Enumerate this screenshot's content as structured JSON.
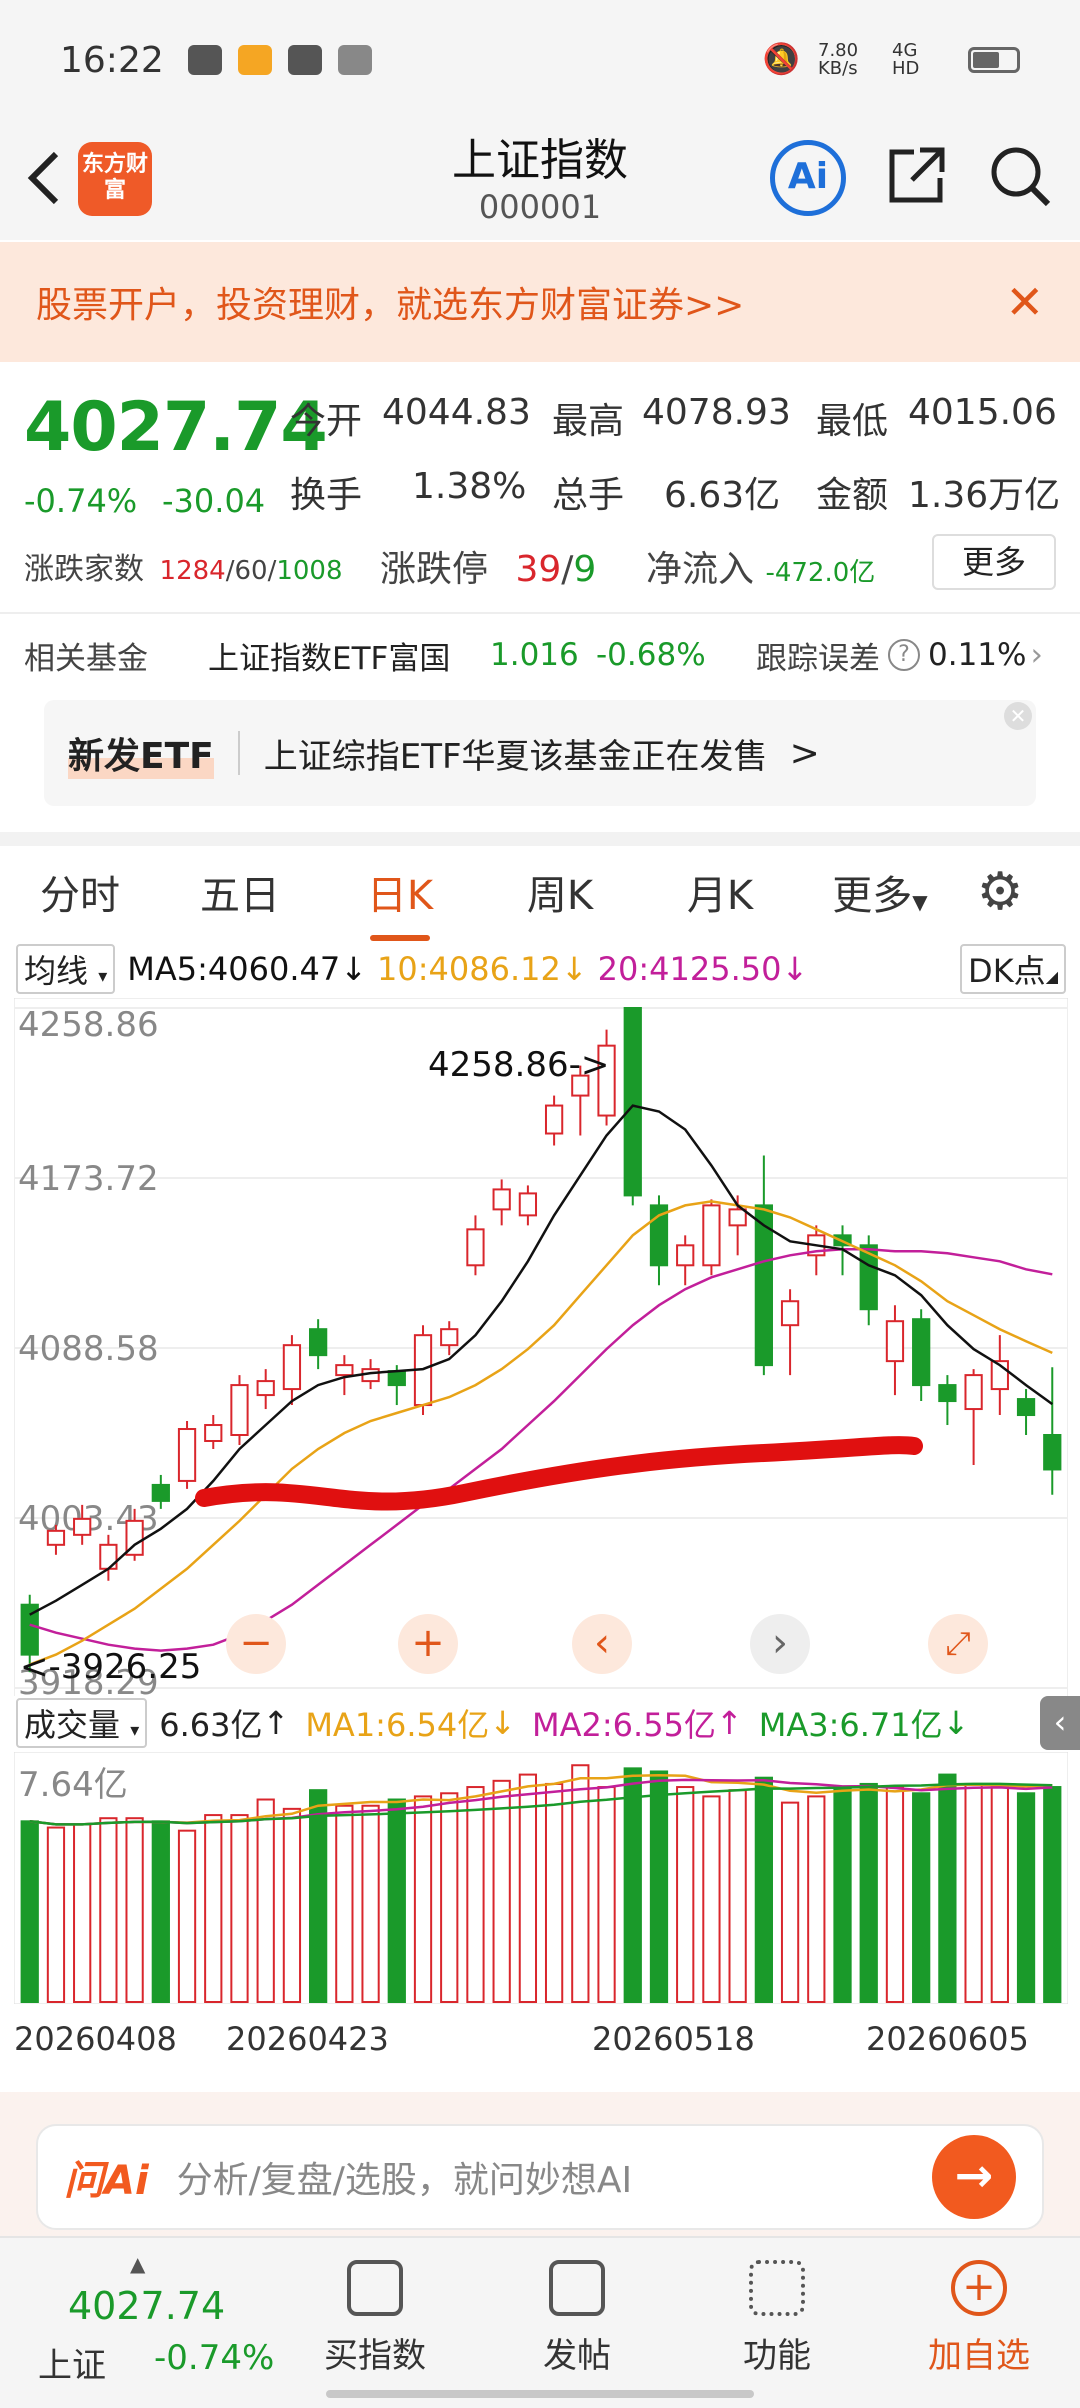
{
  "status": {
    "time": "16:22",
    "speed": "7.80 KB/s",
    "network": "4G HD"
  },
  "header": {
    "logo_text": "东方财富",
    "title": "上证指数",
    "code": "000001",
    "ai_label": "Ai"
  },
  "banner": {
    "text": "股票开户，投资理财，就选东方财富证券>>"
  },
  "quote": {
    "price": "4027.74",
    "change_pct": "-0.74%",
    "change_abs": "-30.04",
    "open_label": "今开",
    "open": "4044.83",
    "high_label": "最高",
    "high": "4078.93",
    "low_label": "最低",
    "low": "4015.06",
    "turnover_label": "换手",
    "turnover": "1.38%",
    "volume_label": "总手",
    "volume": "6.63亿",
    "amount_label": "金额",
    "amount": "1.36万亿",
    "breadth_label": "涨跌家数",
    "breadth_up": "1284",
    "breadth_flat": "60",
    "breadth_down": "1008",
    "limit_label": "涨跌停",
    "limit_up": "39",
    "limit_down": "9",
    "flow_label": "净流入",
    "flow": "-472.0亿",
    "more": "更多"
  },
  "fund": {
    "label": "相关基金",
    "name": "上证指数ETF富国",
    "price": "1.016",
    "change": "-0.68%",
    "track_label": "跟踪误差",
    "track": "0.11%"
  },
  "etf": {
    "tag": "新发ETF",
    "text": "上证综指ETF华夏该基金正在发售",
    "arrow": ">"
  },
  "tabs": [
    "分时",
    "五日",
    "日K",
    "周K",
    "月K",
    "更多"
  ],
  "ma": {
    "select": "均线",
    "ma5": "MA5:4060.47",
    "ma10": "10:4086.12",
    "ma20": "20:4125.50",
    "dk": "DK点"
  },
  "chart_labels": {
    "high_mark": "4258.86->",
    "low_mark": "<-3926.25",
    "y_ticks": [
      "4258.86",
      "4173.72",
      "4088.58",
      "4003.43",
      "3918.29"
    ]
  },
  "volume": {
    "select": "成交量",
    "vol": "6.63亿",
    "ma1": "MA1:6.54亿",
    "ma2": "MA2:6.55亿",
    "ma3": "MA3:6.71亿",
    "top": "7.64亿"
  },
  "dates": [
    "20260408",
    "20260423",
    "20260518",
    "20260605"
  ],
  "ask": {
    "brand": "问Ai",
    "placeholder": "分析/复盘/选股，就问妙想AI"
  },
  "bottom": {
    "price": "4027.74",
    "name": "上证",
    "pct": "-0.74%",
    "buy": "买指数",
    "post": "发帖",
    "func": "功能",
    "add": "加自选"
  },
  "colors": {
    "up": "#d9262c",
    "down": "#1a9a2a",
    "accent": "#e0561a"
  },
  "chart_data": {
    "type": "candlestick",
    "ylim": [
      3918.29,
      4258.86
    ],
    "candles": [
      {
        "o": 3960,
        "c": 3935,
        "h": 3965,
        "l": 3926.25
      },
      {
        "o": 3990,
        "c": 3997,
        "h": 4000,
        "l": 3985
      },
      {
        "o": 3995,
        "c": 4003,
        "h": 4010,
        "l": 3990
      },
      {
        "o": 3978,
        "c": 3990,
        "h": 3995,
        "l": 3972
      },
      {
        "o": 3985,
        "c": 4002,
        "h": 4008,
        "l": 3982
      },
      {
        "o": 4020,
        "c": 4012,
        "h": 4025,
        "l": 4008
      },
      {
        "o": 4022,
        "c": 4048,
        "h": 4052,
        "l": 4018
      },
      {
        "o": 4042,
        "c": 4050,
        "h": 4055,
        "l": 4038
      },
      {
        "o": 4045,
        "c": 4070,
        "h": 4075,
        "l": 4040
      },
      {
        "o": 4065,
        "c": 4072,
        "h": 4078,
        "l": 4058
      },
      {
        "o": 4068,
        "c": 4090,
        "h": 4095,
        "l": 4060
      },
      {
        "o": 4098,
        "c": 4085,
        "h": 4103,
        "l": 4078
      },
      {
        "o": 4075,
        "c": 4080,
        "h": 4085,
        "l": 4065
      },
      {
        "o": 4072,
        "c": 4078,
        "h": 4083,
        "l": 4068
      },
      {
        "o": 4077,
        "c": 4070,
        "h": 4080,
        "l": 4060
      },
      {
        "o": 4060,
        "c": 4095,
        "h": 4100,
        "l": 4055
      },
      {
        "o": 4090,
        "c": 4098,
        "h": 4102,
        "l": 4085
      },
      {
        "o": 4130,
        "c": 4148,
        "h": 4155,
        "l": 4125
      },
      {
        "o": 4158,
        "c": 4168,
        "h": 4173,
        "l": 4150
      },
      {
        "o": 4155,
        "c": 4166,
        "h": 4170,
        "l": 4150
      },
      {
        "o": 4196,
        "c": 4210,
        "h": 4215,
        "l": 4190
      },
      {
        "o": 4215,
        "c": 4225,
        "h": 4230,
        "l": 4195
      },
      {
        "o": 4205,
        "c": 4240,
        "h": 4248,
        "l": 4200
      },
      {
        "o": 4258.86,
        "c": 4165,
        "h": 4258.86,
        "l": 4160
      },
      {
        "o": 4160,
        "c": 4130,
        "h": 4165,
        "l": 4120
      },
      {
        "o": 4130,
        "c": 4140,
        "h": 4145,
        "l": 4120
      },
      {
        "o": 4130,
        "c": 4160,
        "h": 4163,
        "l": 4125
      },
      {
        "o": 4150,
        "c": 4158,
        "h": 4165,
        "l": 4135
      },
      {
        "o": 4160,
        "c": 4080,
        "h": 4185,
        "l": 4075
      },
      {
        "o": 4100,
        "c": 4112,
        "h": 4118,
        "l": 4075
      },
      {
        "o": 4135,
        "c": 4145,
        "h": 4150,
        "l": 4125
      },
      {
        "o": 4145,
        "c": 4140,
        "h": 4150,
        "l": 4125
      },
      {
        "o": 4140,
        "c": 4108,
        "h": 4145,
        "l": 4100
      },
      {
        "o": 4082,
        "c": 4102,
        "h": 4110,
        "l": 4065
      },
      {
        "o": 4103,
        "c": 4070,
        "h": 4108,
        "l": 4062
      },
      {
        "o": 4070,
        "c": 4062,
        "h": 4075,
        "l": 4050
      },
      {
        "o": 4058,
        "c": 4075,
        "h": 4078,
        "l": 4030
      },
      {
        "o": 4068,
        "c": 4082,
        "h": 4095,
        "l": 4055
      },
      {
        "o": 4063,
        "c": 4055,
        "h": 4068,
        "l": 4045
      },
      {
        "o": 4045,
        "c": 4027.74,
        "h": 4078.93,
        "l": 4015.06
      }
    ],
    "ma5": [
      3955,
      3962,
      3970,
      3978,
      3990,
      3998,
      4008,
      4022,
      4038,
      4050,
      4062,
      4070,
      4074,
      4076,
      4077,
      4078,
      4083,
      4095,
      4112,
      4132,
      4155,
      4175,
      4195,
      4210,
      4207,
      4198,
      4180,
      4160,
      4150,
      4142,
      4140,
      4138,
      4130,
      4125,
      4115,
      4100,
      4088,
      4080,
      4070,
      4060.47
    ],
    "ma10": [
      3930,
      3935,
      3942,
      3950,
      3958,
      3968,
      3978,
      3990,
      4002,
      4015,
      4028,
      4038,
      4046,
      4052,
      4056,
      4060,
      4064,
      4070,
      4078,
      4088,
      4100,
      4115,
      4130,
      4145,
      4155,
      4160,
      4162,
      4160,
      4158,
      4154,
      4148,
      4142,
      4136,
      4130,
      4122,
      4112,
      4105,
      4098,
      4092,
      4086.12
    ],
    "ma20": [
      3950,
      3946,
      3943,
      3940,
      3938,
      3937,
      3938,
      3940,
      3945,
      3952,
      3960,
      3970,
      3980,
      3990,
      4000,
      4010,
      4018,
      4028,
      4038,
      4050,
      4062,
      4075,
      4088,
      4100,
      4110,
      4118,
      4124,
      4128,
      4132,
      4135,
      4137,
      4138,
      4138,
      4137,
      4137,
      4136,
      4134,
      4132,
      4128,
      4125.5
    ],
    "volumes": [
      5.8,
      5.6,
      5.7,
      5.9,
      5.9,
      5.8,
      5.5,
      6.0,
      6.0,
      6.5,
      6.2,
      6.8,
      6.3,
      6.3,
      6.5,
      6.6,
      6.7,
      6.9,
      7.1,
      7.3,
      7.0,
      7.6,
      6.9,
      7.5,
      7.4,
      6.9,
      6.6,
      6.8,
      7.2,
      6.4,
      6.6,
      6.9,
      7.0,
      6.9,
      6.7,
      7.3,
      7.0,
      6.9,
      6.7,
      6.9
    ],
    "volume_ylim": [
      0,
      7.64
    ]
  }
}
